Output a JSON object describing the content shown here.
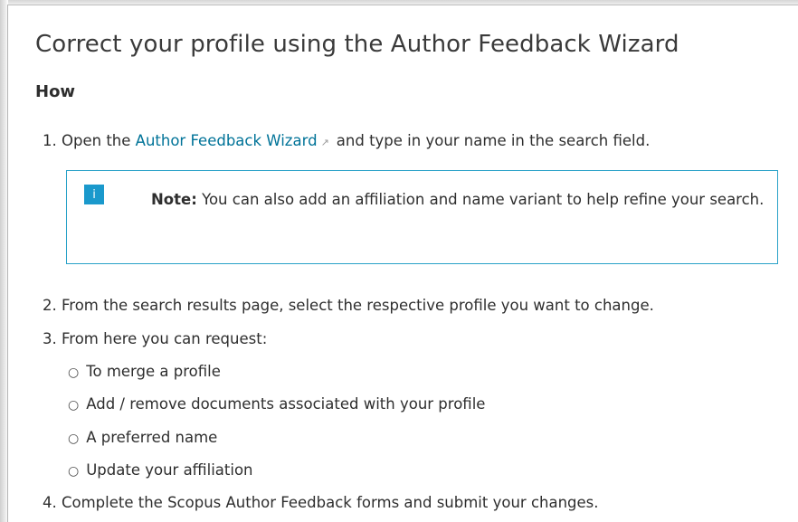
{
  "page": {
    "title": "Correct your profile using the Author Feedback Wizard",
    "subheading": "How"
  },
  "steps": {
    "step1": {
      "number": "1.",
      "prefix": "Open the",
      "link_text": "Author Feedback Wizard",
      "link_icon": "external-link-icon",
      "suffix": "and type in your name in the search field."
    },
    "note": {
      "icon": "info-icon",
      "icon_glyph": "i",
      "label": "Note:",
      "text": "You can also add an affiliation and name variant to help refine your search."
    },
    "step2": "2. From the search results page, select the respective profile you want to change.",
    "step3": "3. From here you can request:",
    "sub_items": [
      "To merge a profile",
      "Add / remove documents associated with your profile",
      "A preferred name",
      "Update your affiliation"
    ],
    "step4": "4. Complete the Scopus Author Feedback forms and submit your changes."
  },
  "colors": {
    "link": "#007398",
    "note_border": "#2aa2c8",
    "note_icon_bg": "#1a99cc",
    "text": "#2e2e2e"
  }
}
